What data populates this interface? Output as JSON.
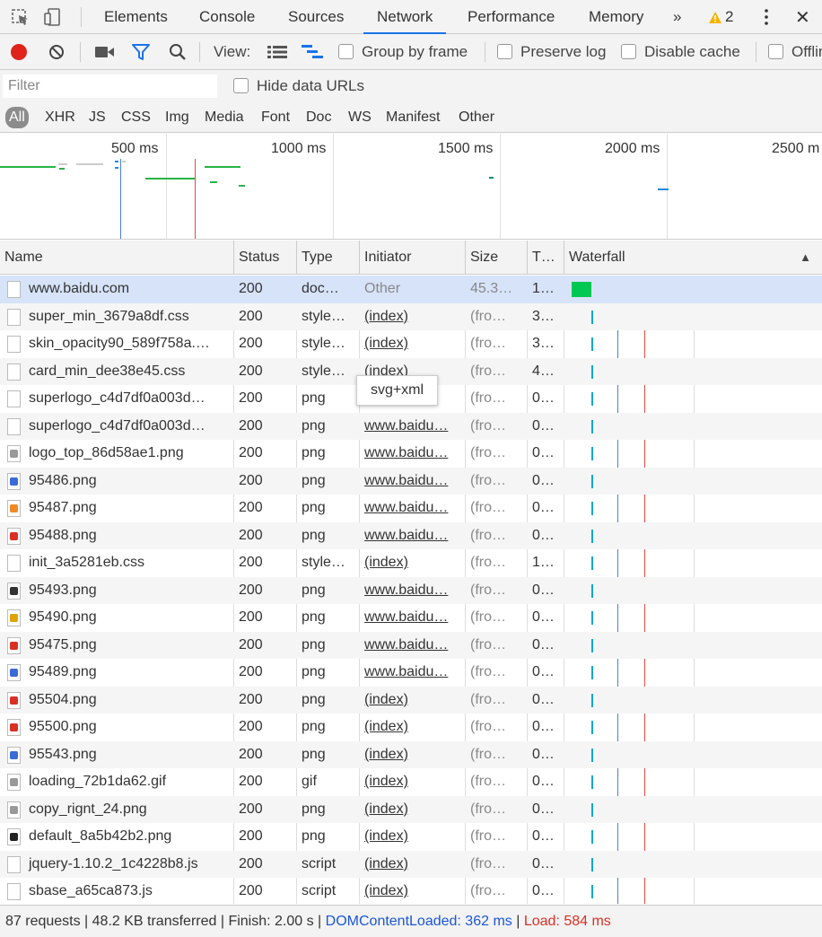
{
  "tabs": [
    "Elements",
    "Console",
    "Sources",
    "Network",
    "Performance",
    "Memory"
  ],
  "active_tab": "Network",
  "more_tabs": "»",
  "warnings": "2",
  "close": "✕",
  "toolbar": {
    "view_label": "View:",
    "group_by_frame": "Group by frame",
    "preserve_log": "Preserve log",
    "disable_cache": "Disable cache",
    "offline": "Offlin"
  },
  "filter": {
    "placeholder": "Filter",
    "hide_data_urls": "Hide data URLs"
  },
  "type_filters": [
    "All",
    "XHR",
    "JS",
    "CSS",
    "Img",
    "Media",
    "Font",
    "Doc",
    "WS",
    "Manifest",
    "Other"
  ],
  "overview": {
    "ticks": [
      "500 ms",
      "1000 ms",
      "1500 ms",
      "2000 ms",
      "2500 m"
    ]
  },
  "columns": {
    "name": "Name",
    "status": "Status",
    "type": "Type",
    "initiator": "Initiator",
    "size": "Size",
    "time": "T…",
    "waterfall": "Waterfall",
    "sort_arrow": "▲"
  },
  "tooltip": "svg+xml",
  "rows": [
    {
      "name": "www.baidu.com",
      "status": "200",
      "type": "doc…",
      "initiator": "Other",
      "size": "45.3…",
      "time": "1…"
    },
    {
      "name": "super_min_3679a8df.css",
      "status": "200",
      "type": "style…",
      "initiator": "(index)",
      "size": "(fro…",
      "time": "3…"
    },
    {
      "name": "skin_opacity90_589f758a.…",
      "status": "200",
      "type": "style…",
      "initiator": "(index)",
      "size": "(fro…",
      "time": "3…"
    },
    {
      "name": "card_min_dee38e45.css",
      "status": "200",
      "type": "style…",
      "initiator": "(index)",
      "size": "(fro…",
      "time": "4…"
    },
    {
      "name": "superlogo_c4d7df0a003d…",
      "status": "200",
      "type": "png",
      "initiator": "…",
      "size": "(fro…",
      "time": "0…"
    },
    {
      "name": "superlogo_c4d7df0a003d…",
      "status": "200",
      "type": "png",
      "initiator": "www.baidu…",
      "size": "(fro…",
      "time": "0…"
    },
    {
      "name": "logo_top_86d58ae1.png",
      "status": "200",
      "type": "png",
      "initiator": "www.baidu…",
      "size": "(fro…",
      "time": "0…"
    },
    {
      "name": "95486.png",
      "status": "200",
      "type": "png",
      "initiator": "www.baidu…",
      "size": "(fro…",
      "time": "0…"
    },
    {
      "name": "95487.png",
      "status": "200",
      "type": "png",
      "initiator": "www.baidu…",
      "size": "(fro…",
      "time": "0…"
    },
    {
      "name": "95488.png",
      "status": "200",
      "type": "png",
      "initiator": "www.baidu…",
      "size": "(fro…",
      "time": "0…"
    },
    {
      "name": "init_3a5281eb.css",
      "status": "200",
      "type": "style…",
      "initiator": "(index)",
      "size": "(fro…",
      "time": "1…"
    },
    {
      "name": "95493.png",
      "status": "200",
      "type": "png",
      "initiator": "www.baidu…",
      "size": "(fro…",
      "time": "0…"
    },
    {
      "name": "95490.png",
      "status": "200",
      "type": "png",
      "initiator": "www.baidu…",
      "size": "(fro…",
      "time": "0…"
    },
    {
      "name": "95475.png",
      "status": "200",
      "type": "png",
      "initiator": "www.baidu…",
      "size": "(fro…",
      "time": "0…"
    },
    {
      "name": "95489.png",
      "status": "200",
      "type": "png",
      "initiator": "www.baidu…",
      "size": "(fro…",
      "time": "0…"
    },
    {
      "name": "95504.png",
      "status": "200",
      "type": "png",
      "initiator": "(index)",
      "size": "(fro…",
      "time": "0…"
    },
    {
      "name": "95500.png",
      "status": "200",
      "type": "png",
      "initiator": "(index)",
      "size": "(fro…",
      "time": "0…"
    },
    {
      "name": "95543.png",
      "status": "200",
      "type": "png",
      "initiator": "(index)",
      "size": "(fro…",
      "time": "0…"
    },
    {
      "name": "loading_72b1da62.gif",
      "status": "200",
      "type": "gif",
      "initiator": "(index)",
      "size": "(fro…",
      "time": "0…"
    },
    {
      "name": "copy_rignt_24.png",
      "status": "200",
      "type": "png",
      "initiator": "(index)",
      "size": "(fro…",
      "time": "0…"
    },
    {
      "name": "default_8a5b42b2.png",
      "status": "200",
      "type": "png",
      "initiator": "(index)",
      "size": "(fro…",
      "time": "0…"
    },
    {
      "name": "jquery-1.10.2_1c4228b8.js",
      "status": "200",
      "type": "script",
      "initiator": "(index)",
      "size": "(fro…",
      "time": "0…"
    },
    {
      "name": "sbase_a65ca873.js",
      "status": "200",
      "type": "script",
      "initiator": "(index)",
      "size": "(fro…",
      "time": "0…"
    }
  ],
  "status_bar": {
    "summary": "87 requests | 48.2 KB transferred | Finish: 2.00 s | ",
    "dcl": "DOMContentLoaded: 362 ms",
    "sep": " | ",
    "load": "Load: 584 ms"
  },
  "colors": {
    "accent": "#1a73e8",
    "record": "#e0241b",
    "dcl": "#1a57d6",
    "load": "#d93025",
    "waterfall_bar": "#00c853",
    "waterfall_tick": "#00a6d6"
  }
}
